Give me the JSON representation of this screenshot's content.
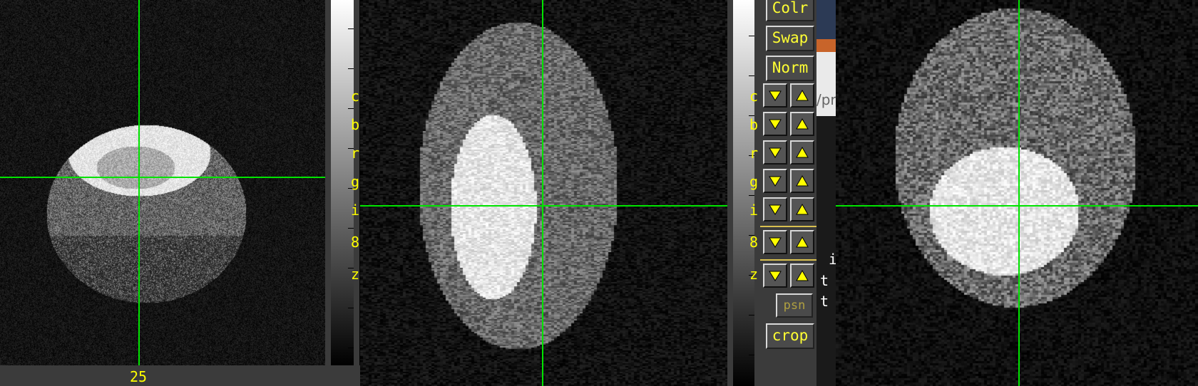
{
  "viewer": {
    "slice_index": "25",
    "channel_letters": [
      "c",
      "b",
      "r",
      "g",
      "i",
      "8",
      "z"
    ],
    "buttons": {
      "colr": "Colr",
      "swap": "Swap",
      "norm": "Norm",
      "psn": "psn",
      "crop": "crop"
    },
    "right_letters": [
      "i",
      "t",
      "t"
    ],
    "url_fragment": "/pr"
  },
  "icons": {
    "down": "triangle-down-icon",
    "up": "triangle-up-icon"
  },
  "colors": {
    "crosshair": "#00e400",
    "label": "#ffff00"
  }
}
